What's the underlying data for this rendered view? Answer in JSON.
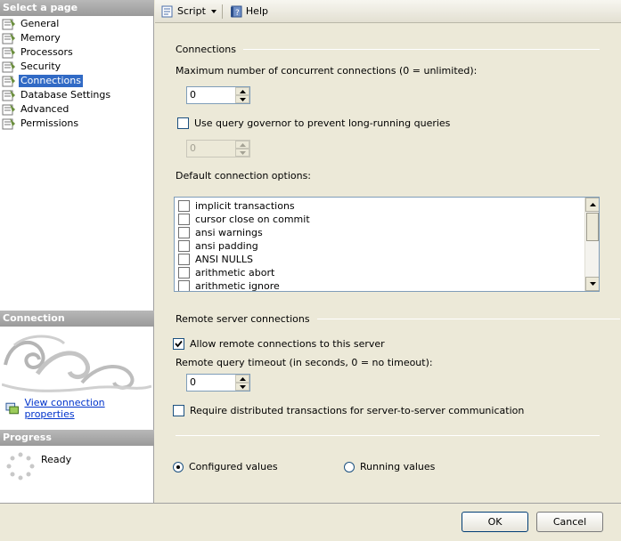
{
  "left_pane": {
    "select_page_header": "Select a page",
    "pages": [
      {
        "label": "General",
        "selected": false
      },
      {
        "label": "Memory",
        "selected": false
      },
      {
        "label": "Processors",
        "selected": false
      },
      {
        "label": "Security",
        "selected": false
      },
      {
        "label": "Connections",
        "selected": true
      },
      {
        "label": "Database Settings",
        "selected": false
      },
      {
        "label": "Advanced",
        "selected": false
      },
      {
        "label": "Permissions",
        "selected": false
      }
    ],
    "connection_header": "Connection",
    "view_connection_link": "View connection properties",
    "progress_header": "Progress",
    "progress_status": "Ready"
  },
  "toolbar": {
    "script_label": "Script",
    "help_label": "Help"
  },
  "connections": {
    "group_title": "Connections",
    "max_connections_label": "Maximum number of concurrent connections (0 = unlimited):",
    "max_connections_value": "0",
    "query_governor_label": "Use query governor to prevent long-running queries",
    "query_governor_checked": false,
    "query_governor_value": "0",
    "default_options_label": "Default connection options:",
    "default_options": [
      {
        "label": "implicit transactions",
        "checked": false
      },
      {
        "label": "cursor close on commit",
        "checked": false
      },
      {
        "label": "ansi warnings",
        "checked": false
      },
      {
        "label": "ansi padding",
        "checked": false
      },
      {
        "label": "ANSI NULLS",
        "checked": false
      },
      {
        "label": "arithmetic abort",
        "checked": false
      },
      {
        "label": "arithmetic ignore",
        "checked": false
      }
    ]
  },
  "remote": {
    "group_title": "Remote server connections",
    "allow_remote_label": "Allow remote connections to this server",
    "allow_remote_checked": true,
    "timeout_label": "Remote query timeout (in seconds, 0 = no timeout):",
    "timeout_value": "0",
    "require_distributed_label": "Require distributed transactions for server-to-server communication",
    "require_distributed_checked": false
  },
  "values_mode": {
    "configured_label": "Configured values",
    "running_label": "Running values",
    "selected": "configured"
  },
  "footer": {
    "ok_label": "OK",
    "cancel_label": "Cancel"
  },
  "colors": {
    "selection": "#316ac5",
    "section_header": "#9a9a9a",
    "link": "#0033cc"
  }
}
